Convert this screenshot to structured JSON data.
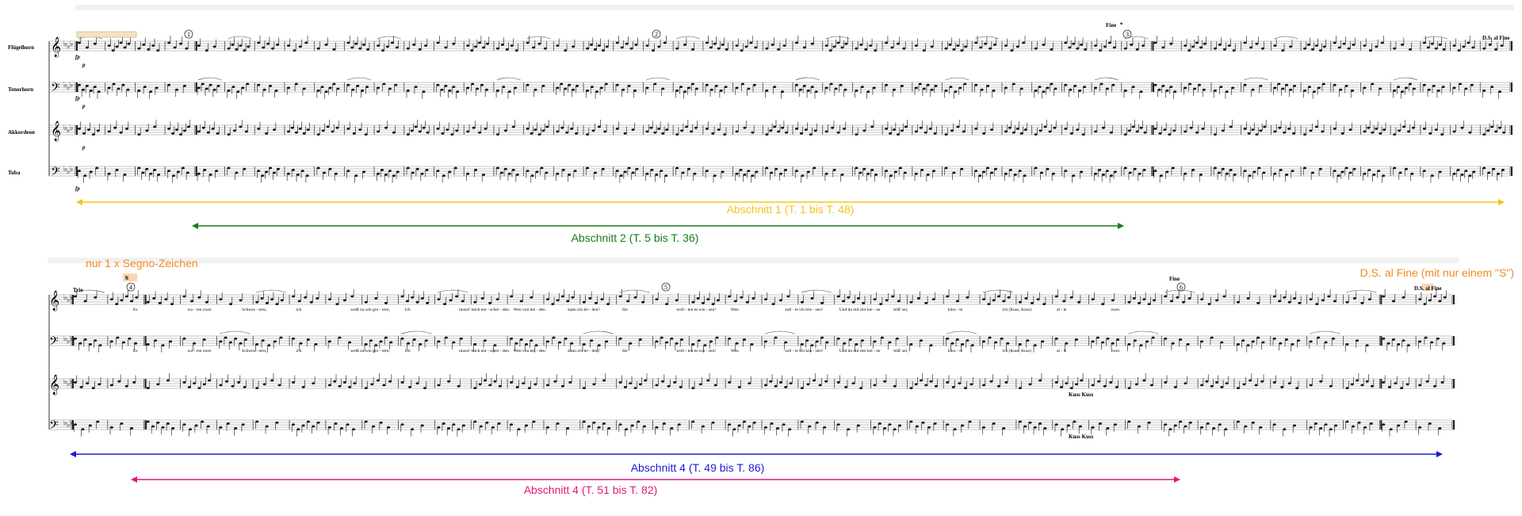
{
  "systems": [
    {
      "id": "system-1",
      "instruments": [
        "Flügelhorn",
        "Tenorhorn",
        "Akkordeon",
        "Tuba"
      ],
      "measure_count": 48,
      "rehearsal_marks": [
        "1",
        "2",
        "3"
      ],
      "fine_label": "Fine",
      "ds_label": "D.S. al Fine",
      "dynamics": [
        "fp",
        "p"
      ]
    },
    {
      "id": "system-2",
      "trio_label": "Trio",
      "measure_count": 38,
      "rehearsal_marks": [
        "4",
        "5",
        "6"
      ],
      "fine_label": "Fine",
      "ds_label": "D.S. al Fine",
      "lyrics": [
        "Es",
        "wa - ren zwei",
        "Schwes - tern,",
        "ich",
        "weiß zu wie gro - tern,",
        "Ich",
        "musst' mich ent - schei - den.",
        "Wen von bei - den",
        "kann ich lei - den?",
        "Sie",
        "woll - ten es wis - sen!",
        "Wen",
        "soll - te ich küs - sen?",
        "Und da mit mir kei - ne",
        "böß' sei,",
        "küss - te",
        "ich (Kuss, Kuss)",
        "al - le",
        "zwei."
      ],
      "chord_labels": [
        "Kuss Kuss"
      ]
    }
  ],
  "annotations": {
    "segno_note": "nur 1 x Segno-Zeichen",
    "ds_note": "D.S. al Fine (mit nur einem \"S\")",
    "spans": [
      {
        "label": "Abschnitt 1 (T. 1 bis T. 48)",
        "color": "#f5c518"
      },
      {
        "label": "Abschnitt 2 (T. 5 bis T. 36)",
        "color": "#1a7a1a"
      },
      {
        "label": "Abschnitt 4 (T. 49 bis T. 86)",
        "color": "#1a1ad6"
      },
      {
        "label": "Abschnitt 4 (T. 51 bis T. 82)",
        "color": "#e0187a"
      }
    ],
    "note_color": "#f08a24"
  }
}
